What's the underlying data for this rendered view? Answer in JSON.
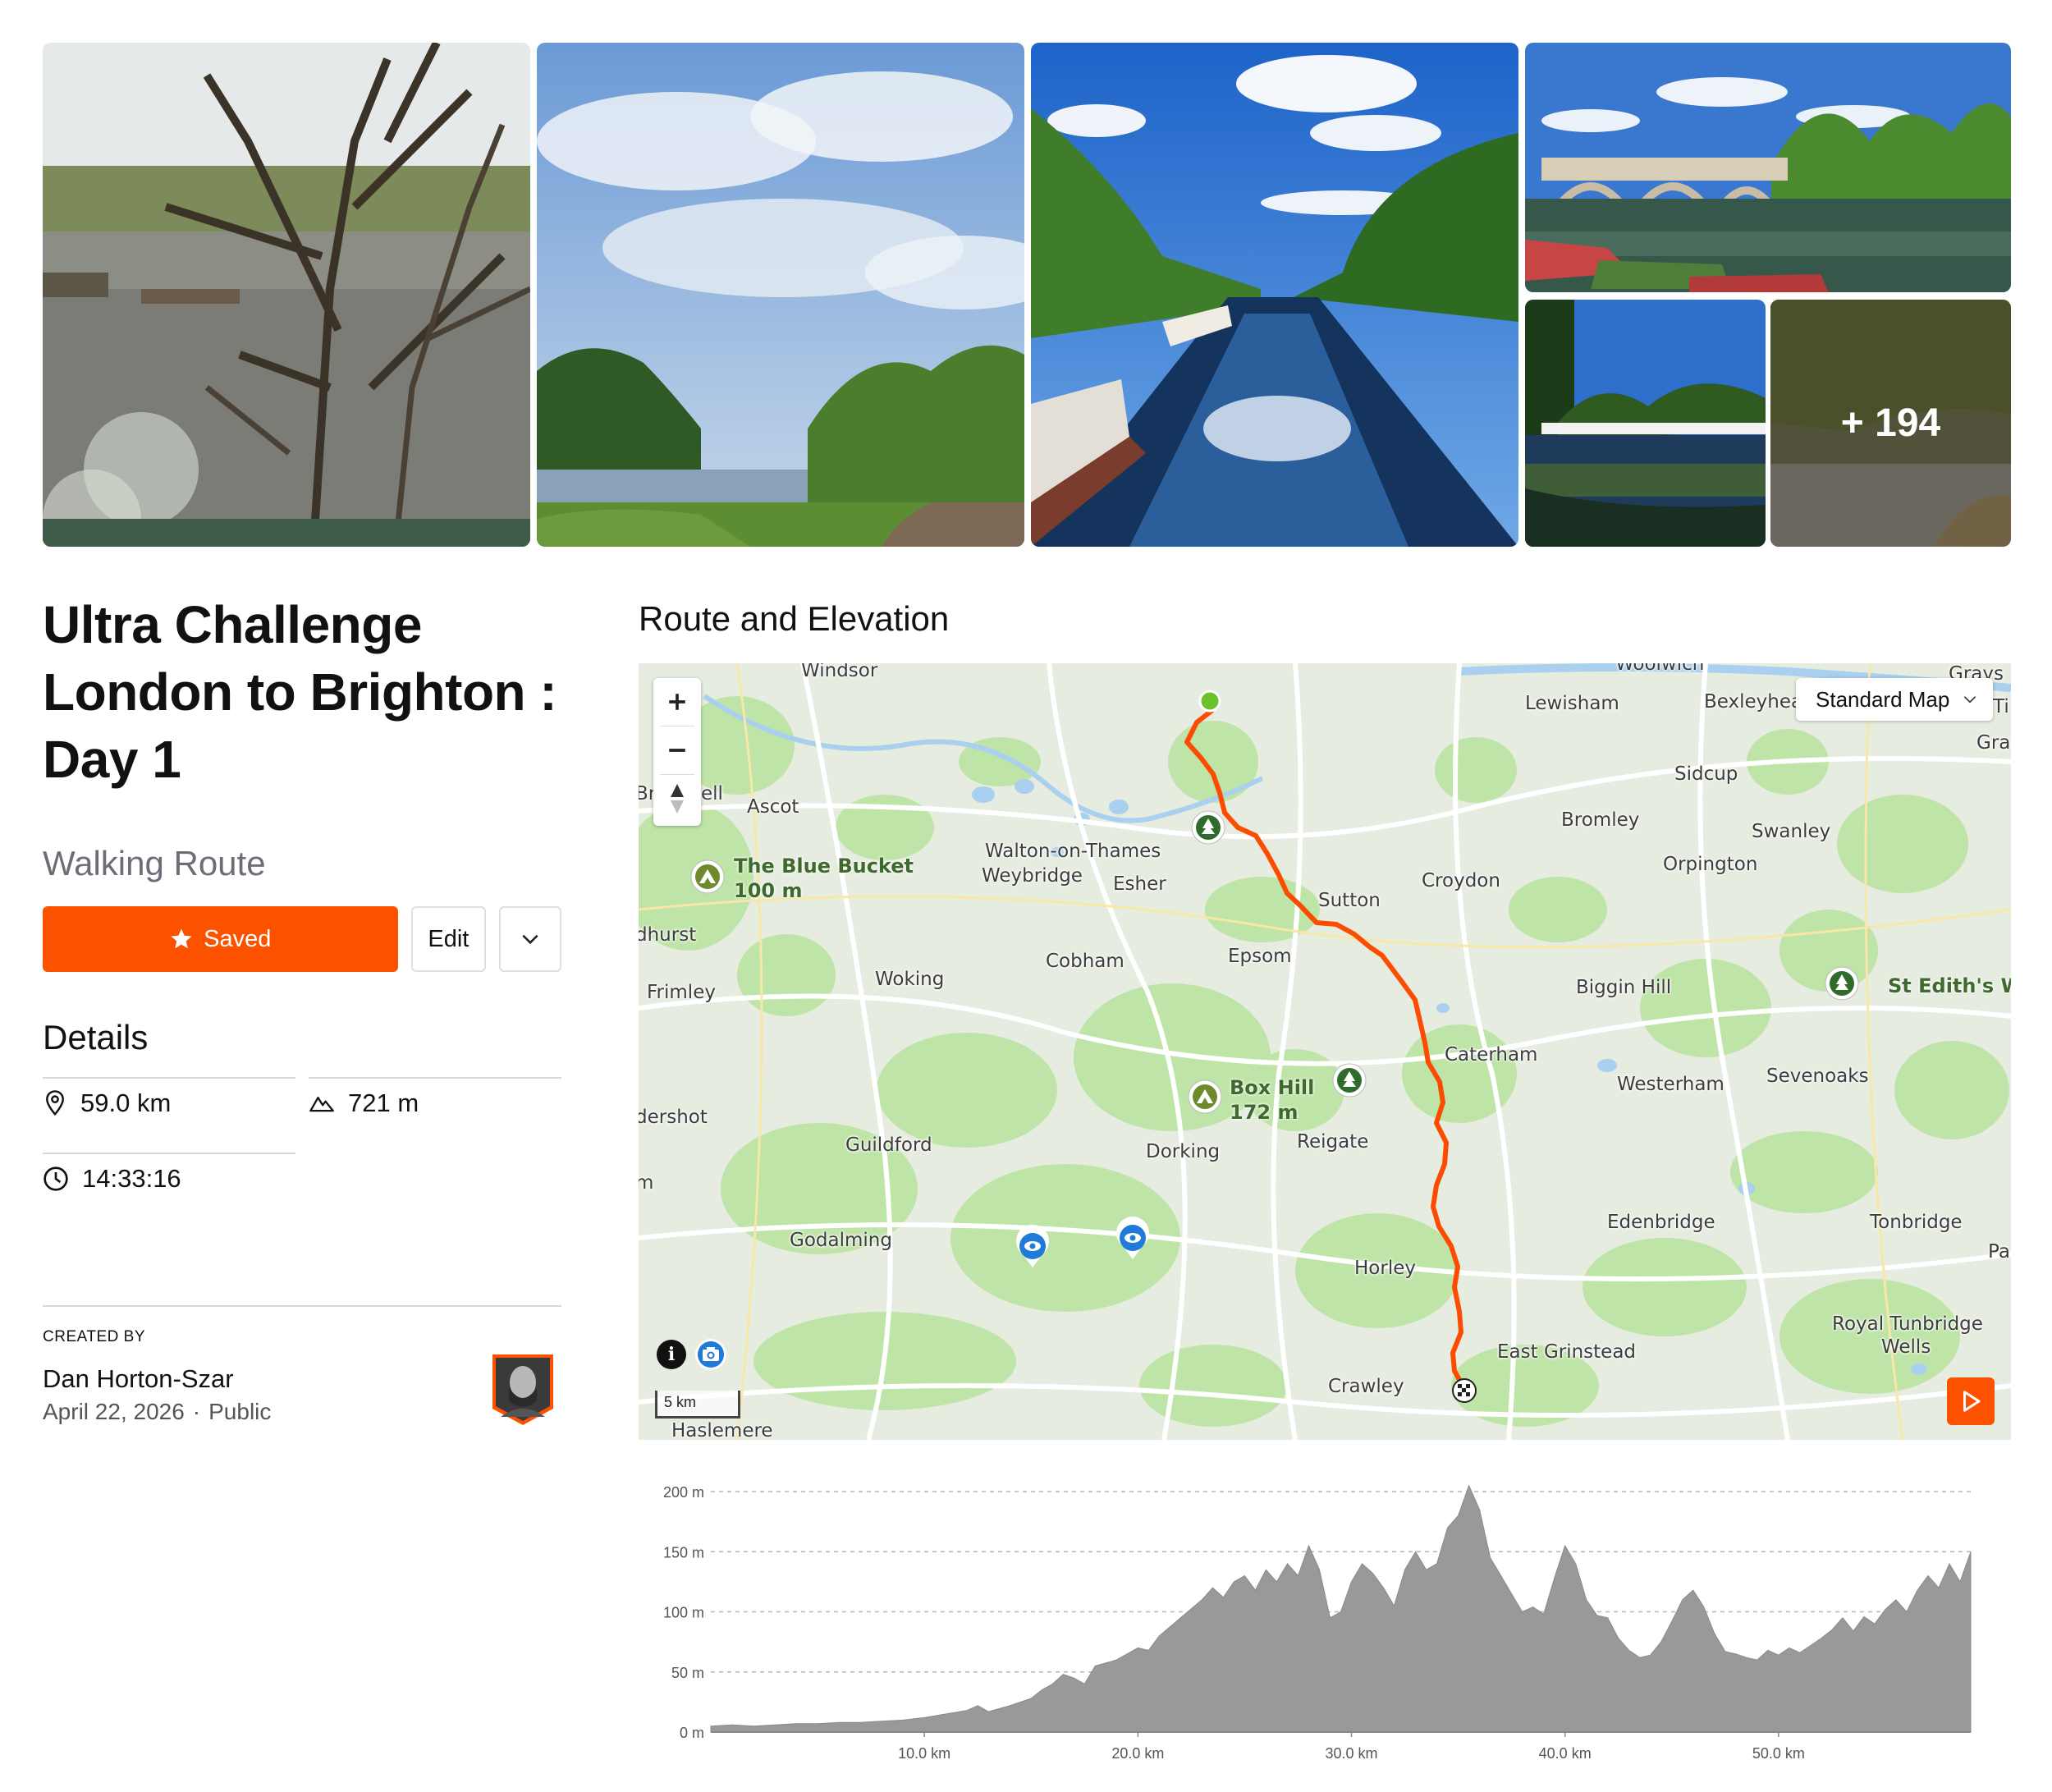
{
  "gallery": {
    "photos": [
      {
        "alt": "riverside tree in blossom"
      },
      {
        "alt": "riverside path under clouds"
      },
      {
        "alt": "canal with moored boats"
      },
      {
        "alt": "stone bridge over river"
      },
      {
        "alt": "river with boats"
      },
      {
        "alt": "riverbank"
      }
    ],
    "more_count": "+ 194"
  },
  "route": {
    "title_lines": [
      "Ultra Challenge",
      "London to Brighton :",
      "Day 1"
    ],
    "type": "Walking Route"
  },
  "actions": {
    "saved_label": "Saved",
    "edit_label": "Edit"
  },
  "details": {
    "heading": "Details",
    "distance": "59.0 km",
    "elevation_gain": "721 m",
    "time": "14:33:16"
  },
  "created": {
    "label": "CREATED BY",
    "name": "Dan Horton-Szar",
    "date": "April 22, 2026",
    "visibility": "Public"
  },
  "section": {
    "title": "Route and Elevation"
  },
  "map": {
    "map_type": "Standard Map",
    "scale": "5 km",
    "colors": {
      "route": "#fc4c02",
      "land": "#e9eee4",
      "park": "#bfe4a8",
      "water": "#a9d0ee",
      "accent": "#fc5200"
    },
    "towns": [
      {
        "name": "Windsor"
      },
      {
        "name": "Woolwich"
      },
      {
        "name": "Grays"
      },
      {
        "name": "Ti"
      },
      {
        "name": "Gra"
      },
      {
        "name": "Lewisham"
      },
      {
        "name": "Bexleyhea"
      },
      {
        "name": "Ascot"
      },
      {
        "name": "Br"
      },
      {
        "name": "ell"
      },
      {
        "name": "Sidcup"
      },
      {
        "name": "Bromley"
      },
      {
        "name": "Swanley"
      },
      {
        "name": "Orpington"
      },
      {
        "name": "Walton-on-Thames"
      },
      {
        "name": "Weybridge"
      },
      {
        "name": "Esher"
      },
      {
        "name": "Croydon"
      },
      {
        "name": "Sutton"
      },
      {
        "name": "dhurst"
      },
      {
        "name": "Cobham"
      },
      {
        "name": "Epsom"
      },
      {
        "name": "Woking"
      },
      {
        "name": "Frimley"
      },
      {
        "name": "Biggin Hill"
      },
      {
        "name": "Caterham"
      },
      {
        "name": "Westerham"
      },
      {
        "name": "Sevenoaks"
      },
      {
        "name": "dershot"
      },
      {
        "name": "Guildford"
      },
      {
        "name": "Dorking"
      },
      {
        "name": "Reigate"
      },
      {
        "name": "m"
      },
      {
        "name": "Godalming"
      },
      {
        "name": "Edenbridge"
      },
      {
        "name": "Tonbridge"
      },
      {
        "name": "Pa"
      },
      {
        "name": "Horley"
      },
      {
        "name": "Royal Tunbridge"
      },
      {
        "name": "Wells"
      },
      {
        "name": "East Grinstead"
      },
      {
        "name": "Crawley"
      },
      {
        "name": "Haslemere"
      }
    ],
    "pois": [
      {
        "name": "The Blue Bucket",
        "sub": "100 m"
      },
      {
        "name": "Box Hill",
        "sub": "172 m"
      },
      {
        "name": "St Edith's W",
        "sub": ""
      }
    ]
  },
  "elevation_chart": {
    "y_ticks": [
      "200 m",
      "150 m",
      "100 m",
      "50 m",
      "0 m"
    ],
    "x_ticks": [
      "10.0 km",
      "20.0 km",
      "30.0 km",
      "40.0 km",
      "50.0 km"
    ]
  },
  "chart_data": {
    "type": "area",
    "title": "",
    "xlabel": "",
    "ylabel": "",
    "xlim": [
      0,
      59.0
    ],
    "ylim": [
      0,
      200
    ],
    "grid": true,
    "x": [
      0,
      1,
      2,
      3,
      4,
      5,
      6,
      7,
      8,
      9,
      10,
      11,
      12,
      12.5,
      13,
      14,
      15,
      15.5,
      16,
      16.5,
      17,
      17.5,
      18,
      19,
      20,
      20.5,
      21,
      22,
      23,
      23.5,
      24,
      24.5,
      25,
      25.5,
      26,
      26.5,
      27,
      27.5,
      28,
      28.5,
      29,
      29.5,
      30,
      30.5,
      31,
      31.5,
      32,
      32.5,
      33,
      33.5,
      34,
      34.5,
      35,
      35.5,
      36,
      36.5,
      37,
      37.5,
      38,
      38.5,
      39,
      39.5,
      40,
      40.5,
      41,
      41.5,
      42,
      42.5,
      43,
      43.5,
      44,
      44.5,
      45,
      45.5,
      46,
      46.5,
      47,
      47.5,
      48,
      48.5,
      49,
      49.5,
      50,
      50.5,
      51,
      51.5,
      52,
      52.5,
      53,
      53.5,
      54,
      54.5,
      55,
      55.5,
      56,
      56.5,
      57,
      57.5,
      58,
      58.5,
      59
    ],
    "series": [
      {
        "values": [
          5,
          6,
          5,
          6,
          7,
          7,
          8,
          8,
          9,
          10,
          12,
          15,
          18,
          22,
          17,
          22,
          28,
          35,
          40,
          48,
          45,
          40,
          55,
          60,
          70,
          68,
          80,
          95,
          110,
          120,
          112,
          125,
          130,
          118,
          135,
          125,
          140,
          130,
          155,
          135,
          95,
          100,
          125,
          140,
          132,
          120,
          105,
          135,
          150,
          135,
          140,
          170,
          180,
          205,
          185,
          145,
          130,
          115,
          100,
          104,
          98,
          128,
          155,
          140,
          110,
          97,
          95,
          78,
          68,
          62,
          64,
          75,
          92,
          110,
          118,
          104,
          82,
          67,
          65,
          62,
          60,
          68,
          64,
          70,
          66,
          72,
          78,
          85,
          95,
          84,
          96,
          90,
          102,
          110,
          100,
          118,
          130,
          120,
          140,
          125,
          150,
          142,
          148
        ]
      }
    ]
  }
}
